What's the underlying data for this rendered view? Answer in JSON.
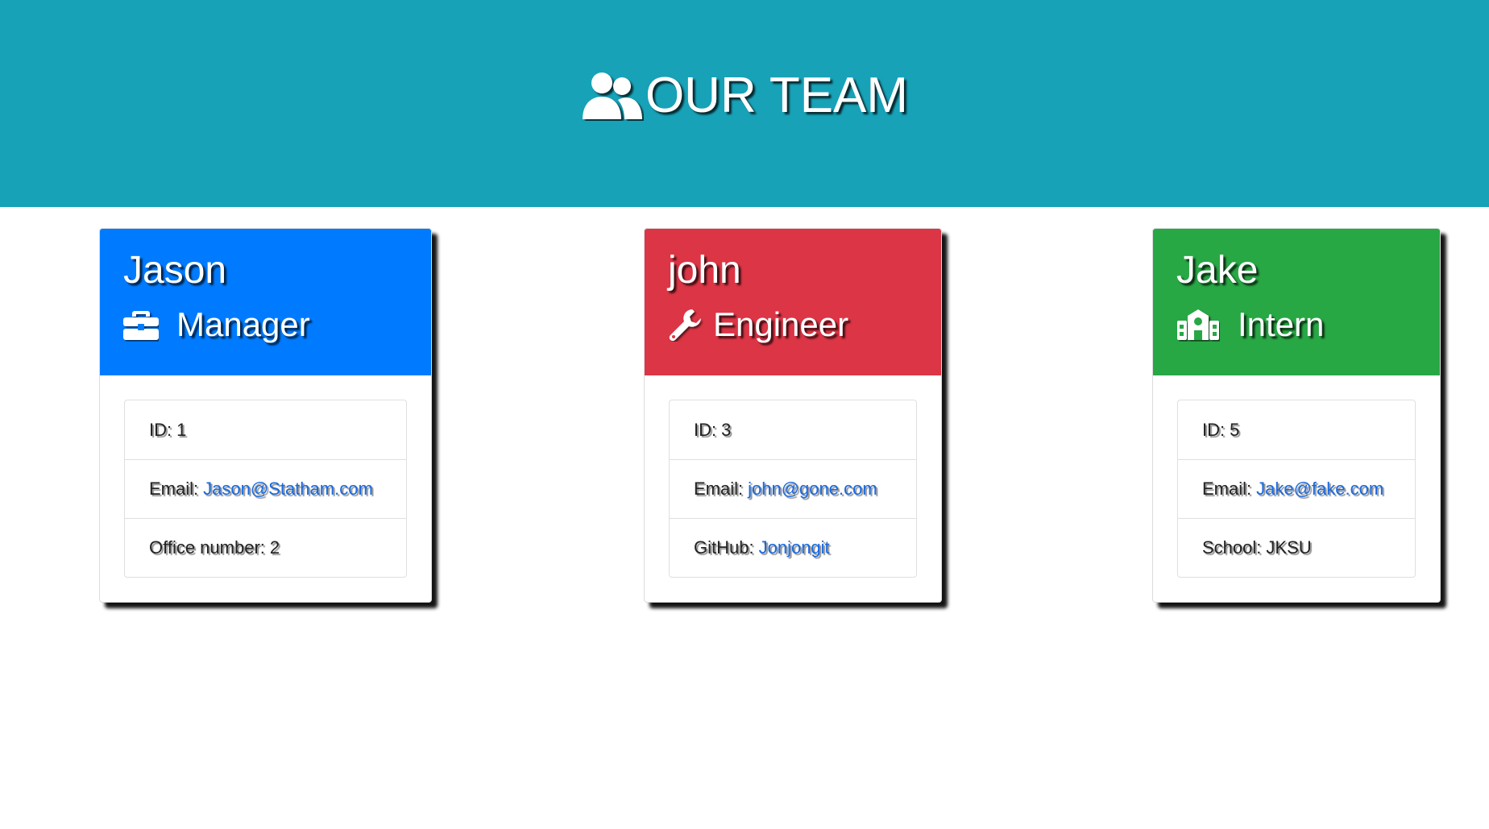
{
  "header": {
    "title": "OUR TEAM",
    "icon": "users-icon",
    "background": "#17a2b8"
  },
  "team": [
    {
      "name": "Jason",
      "role": "Manager",
      "role_icon": "briefcase-icon",
      "color": "#007bff",
      "details": [
        {
          "label": "ID:",
          "value": "1"
        },
        {
          "label": "Email:",
          "value": "Jason@Statham.com"
        },
        {
          "label": "Office number:",
          "value": "2"
        }
      ]
    },
    {
      "name": "john",
      "role": "Engineer",
      "role_icon": "wrench-icon",
      "color": "#dc3545",
      "details": [
        {
          "label": "ID:",
          "value": "3"
        },
        {
          "label": "Email:",
          "value": "john@gone.com"
        },
        {
          "label": "GitHub:",
          "value": "Jonjongit"
        }
      ]
    },
    {
      "name": "Jake",
      "role": "Intern",
      "role_icon": "school-icon",
      "color": "#28a745",
      "details": [
        {
          "label": "ID:",
          "value": "5"
        },
        {
          "label": "Email:",
          "value": "Jake@fake.com"
        },
        {
          "label": "School:",
          "value": "JKSU"
        }
      ]
    }
  ]
}
